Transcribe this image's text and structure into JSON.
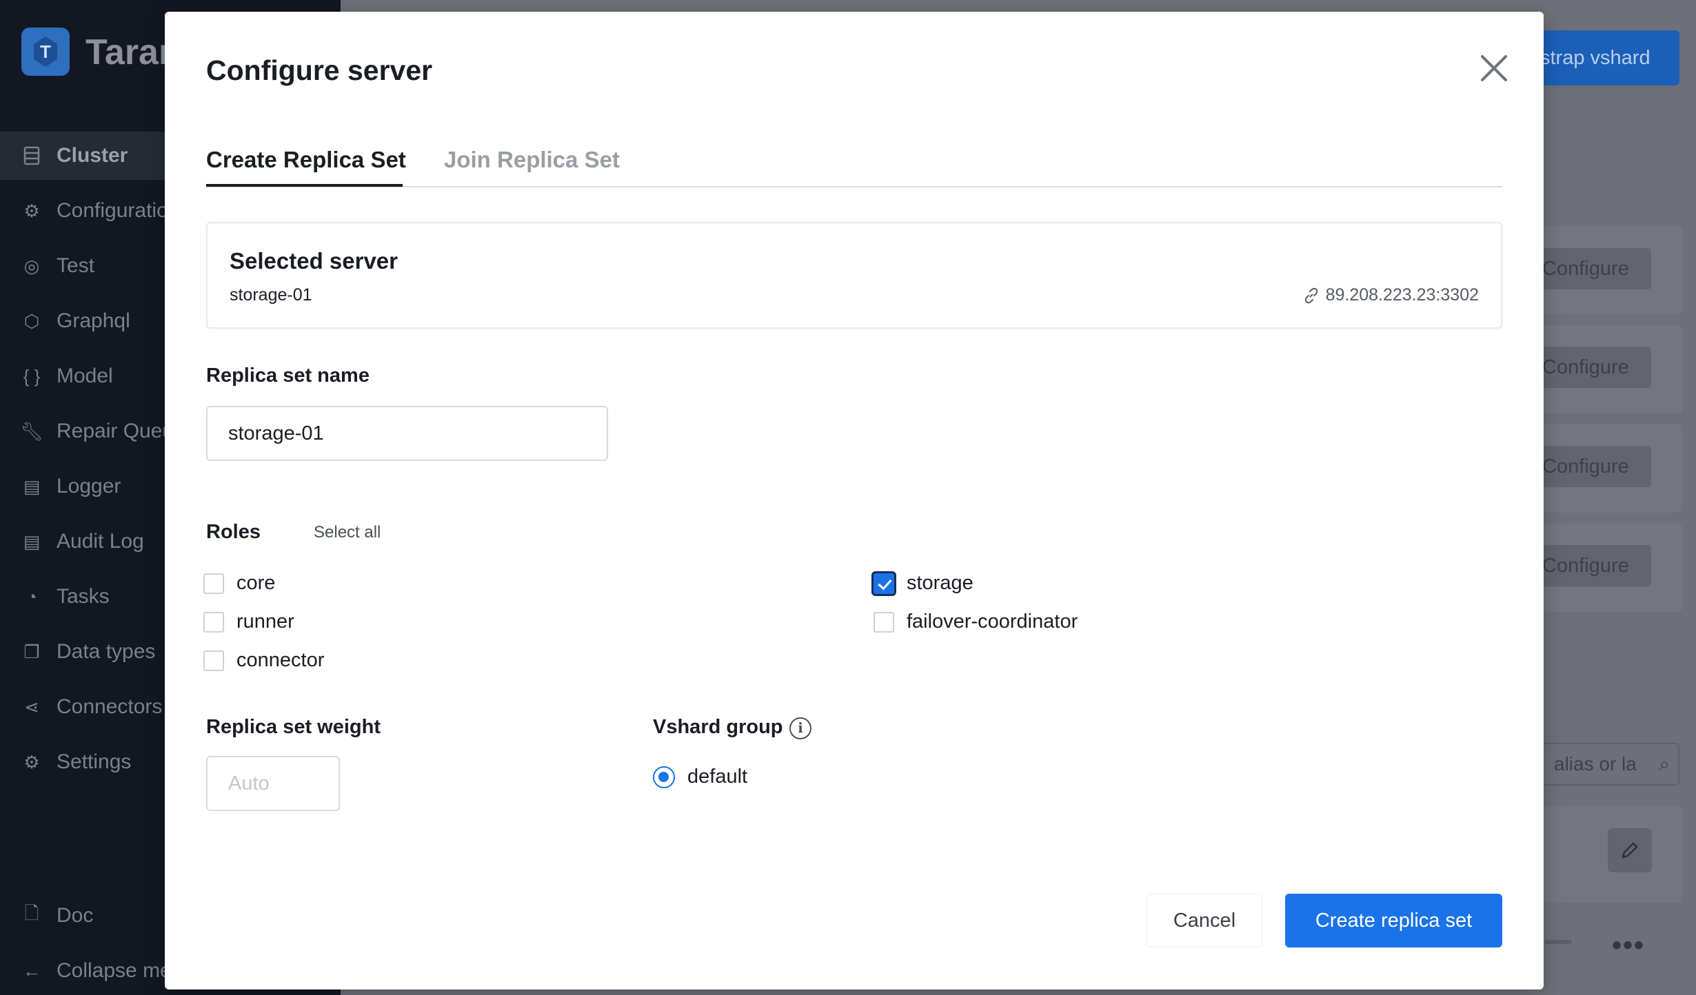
{
  "app": {
    "logo_letter": "T",
    "logo_text": "Taran",
    "sidebar": {
      "items": [
        {
          "label": "Cluster",
          "icon": "cluster-icon",
          "active": true
        },
        {
          "label": "Configuratio",
          "icon": "gear-icon"
        },
        {
          "label": "Test",
          "icon": "test-icon"
        },
        {
          "label": "Graphql",
          "icon": "graphql-icon"
        },
        {
          "label": "Model",
          "icon": "braces-icon"
        },
        {
          "label": "Repair Queu",
          "icon": "wrench-icon"
        },
        {
          "label": "Logger",
          "icon": "logger-icon"
        },
        {
          "label": "Audit Log",
          "icon": "audit-log-icon"
        },
        {
          "label": "Tasks",
          "icon": "tasks-icon"
        },
        {
          "label": "Data types",
          "icon": "data-types-icon"
        },
        {
          "label": "Connectors",
          "icon": "connectors-icon"
        },
        {
          "label": "Settings",
          "icon": "settings-icon"
        }
      ],
      "bottom": [
        {
          "label": "Doc",
          "icon": "doc-icon"
        },
        {
          "label": "Collapse me",
          "icon": "arrow-left-icon"
        }
      ]
    },
    "header": {
      "bootstrap_label": "strap vshard"
    },
    "configure_label": "Configure",
    "search_placeholder": "alias or la"
  },
  "modal": {
    "title": "Configure server",
    "tabs": [
      {
        "label": "Create Replica Set",
        "active": true
      },
      {
        "label": "Join Replica Set",
        "active": false
      }
    ],
    "selected_server": {
      "title": "Selected server",
      "name": "storage-01",
      "uri": "89.208.223.23:3302"
    },
    "replica_set_name": {
      "label": "Replica set name",
      "value": "storage-01"
    },
    "roles": {
      "label": "Roles",
      "select_all": "Select all",
      "items": [
        {
          "label": "core",
          "checked": false
        },
        {
          "label": "runner",
          "checked": false
        },
        {
          "label": "connector",
          "checked": false
        },
        {
          "label": "storage",
          "checked": true
        },
        {
          "label": "failover-coordinator",
          "checked": false
        }
      ]
    },
    "weight": {
      "label": "Replica set weight",
      "placeholder": "Auto"
    },
    "vshard_group": {
      "label": "Vshard group",
      "option": "default",
      "selected": true
    },
    "buttons": {
      "cancel": "Cancel",
      "create": "Create replica set"
    },
    "colors": {
      "primary": "#1a73e8",
      "text": "#1a1d24",
      "muted": "#9a9da4"
    }
  }
}
